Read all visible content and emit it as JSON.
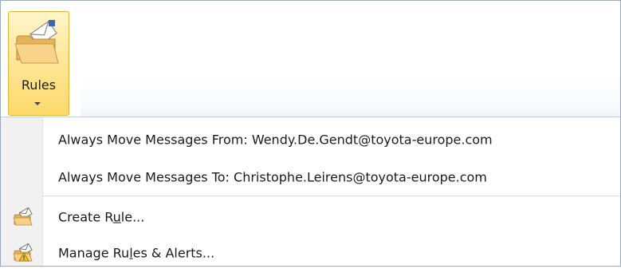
{
  "ribbon": {
    "rules_label": "Rules"
  },
  "menu": {
    "items": [
      {
        "label": "Always Move Messages From: Wendy.De.Gendt@toyota-europe.com"
      },
      {
        "label": "Always Move Messages To: Christophe.Leirens@toyota-europe.com"
      },
      {
        "label_pre": "Create R",
        "label_acc": "u",
        "label_post": "le...",
        "icon": "create-rule-icon"
      },
      {
        "label_pre": "Manage Ru",
        "label_acc": "l",
        "label_post": "es & Alerts...",
        "icon": "manage-rules-icon"
      }
    ]
  },
  "colors": {
    "button_highlight": "#fde79a",
    "button_border": "#e7b53c",
    "gutter": "#f1f1f1"
  }
}
